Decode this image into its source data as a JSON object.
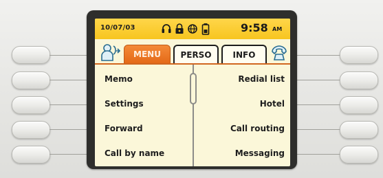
{
  "status": {
    "date": "10/07/03",
    "time": "9:58",
    "ampm": "AM",
    "icons": [
      "headset-icon",
      "lock-icon",
      "globe-icon",
      "battery-icon"
    ],
    "accent": "#f7c51f"
  },
  "tabs": {
    "menu_label": "MENU",
    "perso_label": "PERSO",
    "info_label": "INFO",
    "active_color": "#e46a18"
  },
  "menu": {
    "left": [
      "Memo",
      "Settings",
      "Forward",
      "Call by name"
    ],
    "right": [
      "Redial list",
      "Hotel",
      "Call routing",
      "Messaging"
    ]
  }
}
